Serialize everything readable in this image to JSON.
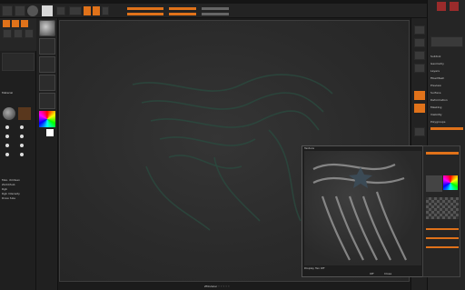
{
  "app": {
    "title": ""
  },
  "colors": {
    "accent": "#e0721a",
    "canvas_bg": "#2b2b2b",
    "panel_bg": "#252525"
  },
  "left_panel": {
    "section_title": "Material",
    "labels": [
      "Blur",
      "Alt",
      "Smt"
    ],
    "side_items": [
      "Max. XmlGen",
      "ZAdd/Sub",
      "Rgb",
      "Rgb Intensity",
      "Draw Size"
    ]
  },
  "canvas": {
    "footer_text": "ZModeler ◦ ◦ ◦ ◦ ◦"
  },
  "texture_window": {
    "title": "Texture",
    "footer_label": "Display Tex Off",
    "buttons": [
      "Off",
      "Close"
    ]
  },
  "right_panel": {
    "items": [
      "Subtool",
      "Geometry",
      "Layers",
      "FiberMesh",
      "Preview",
      "Surface",
      "Deformation",
      "Masking",
      "Visibility",
      "Polygroups"
    ]
  },
  "icons": [
    "brush-icon",
    "sphere-icon",
    "alpha-icon",
    "texture-icon",
    "material-icon",
    "color-picker-icon",
    "gear-icon"
  ]
}
